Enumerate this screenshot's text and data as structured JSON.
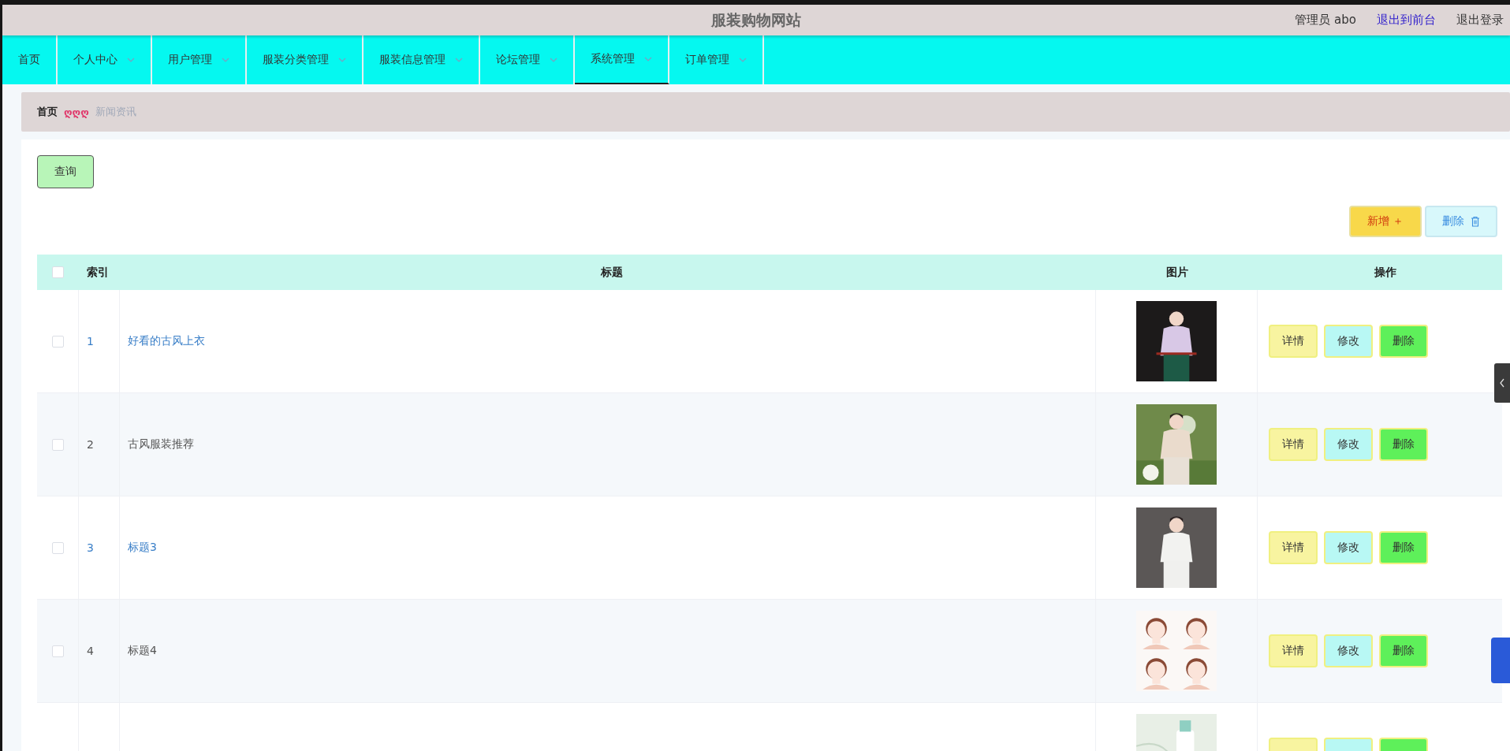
{
  "header": {
    "title": "服装购物网站",
    "user": "管理员 abo",
    "front_link": "退出到前台",
    "logout": "退出登录"
  },
  "nav": [
    {
      "label": "首页",
      "dropdown": false,
      "selected": false
    },
    {
      "label": "个人中心",
      "dropdown": true,
      "selected": false
    },
    {
      "label": "用户管理",
      "dropdown": true,
      "selected": false
    },
    {
      "label": "服装分类管理",
      "dropdown": true,
      "selected": false
    },
    {
      "label": "服装信息管理",
      "dropdown": true,
      "selected": false
    },
    {
      "label": "论坛管理",
      "dropdown": true,
      "selected": false
    },
    {
      "label": "系统管理",
      "dropdown": true,
      "selected": true
    },
    {
      "label": "订单管理",
      "dropdown": true,
      "selected": false
    }
  ],
  "breadcrumb": {
    "home": "首页",
    "separator": "ღღღ",
    "current": "新闻资讯"
  },
  "search_button": "查询",
  "toolbar": {
    "add": "新增 ＋",
    "delete": "删除"
  },
  "table": {
    "select_all": {
      "checked": false
    },
    "columns": [
      "索引",
      "标题",
      "图片",
      "操作"
    ],
    "rows": [
      {
        "checked": false,
        "index": "1",
        "title": "好看的古风上衣",
        "link": true,
        "image": {
          "kind": "picture"
        },
        "actions": [
          "详情",
          "修改",
          "删除"
        ]
      },
      {
        "checked": false,
        "index": "2",
        "title": "古风服装推荐",
        "link": false,
        "image": {
          "kind": "picture"
        },
        "actions": [
          "详情",
          "修改",
          "删除"
        ]
      },
      {
        "checked": false,
        "index": "3",
        "title": "标题3",
        "link": true,
        "image": {
          "kind": "picture"
        },
        "actions": [
          "详情",
          "修改",
          "删除"
        ]
      },
      {
        "checked": false,
        "index": "4",
        "title": "标题4",
        "link": false,
        "image": {
          "kind": "picture"
        },
        "actions": [
          "详情",
          "修改",
          "删除"
        ]
      },
      {
        "image": {
          "kind": "picture"
        },
        "actions_cut": true
      }
    ]
  }
}
